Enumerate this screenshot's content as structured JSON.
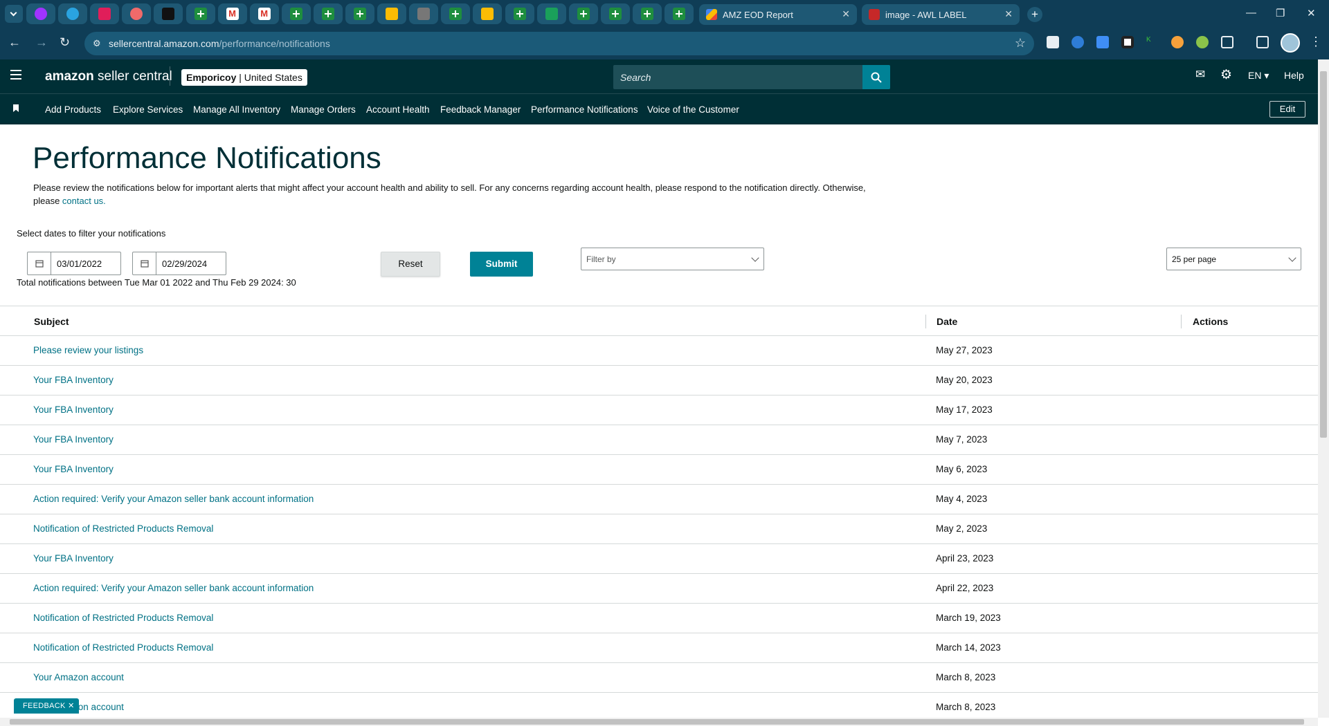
{
  "browser": {
    "tabs": [
      {
        "title": "AMZ EOD Report",
        "icon": "apps-script-icon"
      },
      {
        "title": "image - AWL LABEL",
        "icon": "label-icon"
      }
    ],
    "pinned_icons": [
      "messenger-icon",
      "telegram-icon",
      "slack-icon",
      "asana-icon",
      "amazon-icon",
      "sheets-icon",
      "gmail-icon",
      "gmail-icon",
      "sheets-icon",
      "sheets-icon",
      "sheets-icon",
      "apps-script-icon",
      "circle-icon",
      "sheets-icon",
      "apps-script-icon",
      "sheets-icon",
      "w-icon",
      "sheets-icon",
      "sheets-icon",
      "sheets-icon",
      "sheets-icon"
    ],
    "url_host": "sellercentral.amazon.com",
    "url_path": "/performance/notifications"
  },
  "header": {
    "logo_bold": "amazon",
    "logo_rest": " seller central",
    "store_name": "Emporicoy",
    "store_region": " | United States",
    "search_placeholder": "Search",
    "language": "EN",
    "help": "Help"
  },
  "nav": {
    "items": [
      "Add Products",
      "Explore Services",
      "Manage All Inventory",
      "Manage Orders",
      "Account Health",
      "Feedback Manager",
      "Performance Notifications",
      "Voice of the Customer"
    ],
    "edit": "Edit"
  },
  "page": {
    "title": "Performance Notifications",
    "intro": "Please review the notifications below for important alerts that might affect your account health and ability to sell. For any concerns regarding account health, please respond to the notification directly. Otherwise, please ",
    "contact_link": "contact us.",
    "filter_label": "Select dates to filter your notifications",
    "date_from": "03/01/2022",
    "date_to": "02/29/2024",
    "total": "Total notifications between Tue Mar 01 2022 and Thu Feb 29 2024: 30",
    "reset": "Reset",
    "submit": "Submit",
    "filter_by": "Filter by",
    "per_page": "25 per page",
    "feedback": "FEEDBACK"
  },
  "table": {
    "headers": {
      "subject": "Subject",
      "date": "Date",
      "actions": "Actions"
    },
    "rows": [
      {
        "subject": "Please review your listings",
        "date": "May 27, 2023"
      },
      {
        "subject": "Your FBA Inventory",
        "date": "May 20, 2023"
      },
      {
        "subject": "Your FBA Inventory",
        "date": "May 17, 2023"
      },
      {
        "subject": "Your FBA Inventory",
        "date": "May 7, 2023"
      },
      {
        "subject": "Your FBA Inventory",
        "date": "May 6, 2023"
      },
      {
        "subject": "Action required: Verify your Amazon seller bank account information",
        "date": "May 4, 2023"
      },
      {
        "subject": "Notification of Restricted Products Removal",
        "date": "May 2, 2023"
      },
      {
        "subject": "Your FBA Inventory",
        "date": "April 23, 2023"
      },
      {
        "subject": "Action required: Verify your Amazon seller bank account information",
        "date": "April 22, 2023"
      },
      {
        "subject": "Notification of Restricted Products Removal",
        "date": "March 19, 2023"
      },
      {
        "subject": "Notification of Restricted Products Removal",
        "date": "March 14, 2023"
      },
      {
        "subject": "Your Amazon account",
        "date": "March 8, 2023"
      },
      {
        "subject": "Your Amazon account",
        "date": "March 8, 2023"
      }
    ]
  },
  "colors": {
    "accent": "#008296",
    "link": "#007185",
    "header_bg": "#002f36",
    "browser_bg": "#0f3d56"
  }
}
